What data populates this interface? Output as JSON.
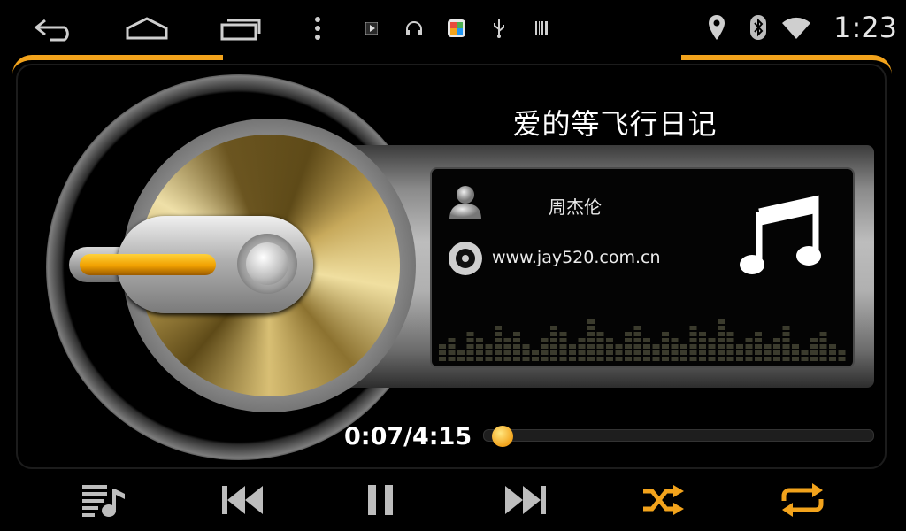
{
  "status_bar": {
    "time": "1:23",
    "nav_icons": [
      "back-icon",
      "home-icon",
      "recent-apps-icon",
      "overflow-menu-icon"
    ],
    "notification_icons": [
      "play-notification-icon",
      "headset-icon",
      "app-notification-icon",
      "usb-icon",
      "barcode-icon"
    ],
    "system_icons": [
      "location-icon",
      "bluetooth-icon",
      "wifi-icon"
    ]
  },
  "colors": {
    "accent": "#f2a31c",
    "background": "#000000"
  },
  "player": {
    "song_title": "爱的等飞行日记",
    "artist": "周杰伦",
    "album": "www.jay520.com.cn",
    "elapsed_total": "0:07/4:15",
    "progress": 0.027
  },
  "controls": [
    "playlist-icon",
    "previous-icon",
    "pause-icon",
    "next-icon",
    "shuffle-icon",
    "repeat-icon"
  ]
}
